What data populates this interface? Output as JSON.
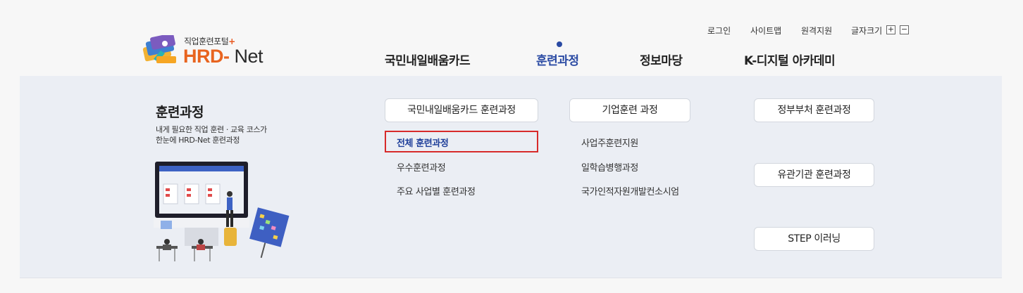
{
  "header": {
    "logo": {
      "sub": "직업훈련포털",
      "plus": "+",
      "main_a": "HRD",
      "main_dash": "-",
      "main_b": "Net"
    },
    "util": {
      "login": "로그인",
      "sitemap": "사이트맵",
      "remote": "원격지원",
      "font_size": "글자크기",
      "plus": "+",
      "minus": "−"
    },
    "gnb": [
      {
        "label": "국민내일배움카드"
      },
      {
        "label": "훈련과정"
      },
      {
        "label": "정보마당"
      },
      {
        "label": "K-디지털 아카데미"
      }
    ],
    "active_index": 1
  },
  "panel": {
    "title": "훈련과정",
    "desc_line1": "내게 필요한 직업 훈련 · 교육 코스가",
    "desc_line2": "한눈에 HRD-Net 훈련과정",
    "col1": {
      "heading": "국민내일배움카드 훈련과정",
      "links": [
        "전체 훈련과정",
        "우수훈련과정",
        "주요 사업별 훈련과정"
      ],
      "selected_index": 0
    },
    "col2": {
      "heading": "기업훈련 과정",
      "links": [
        "사업주훈련지원",
        "일학습병행과정",
        "국가인적자원개발컨소시엄"
      ]
    },
    "col3": {
      "buttons": [
        "정부부처 훈련과정",
        "유관기관 훈련과정",
        "STEP 이러닝"
      ]
    }
  },
  "colors": {
    "accent": "#2a4aa3",
    "brand": "#e8641f",
    "highlight": "#d72a2a",
    "panel_bg": "#ebeef4"
  }
}
